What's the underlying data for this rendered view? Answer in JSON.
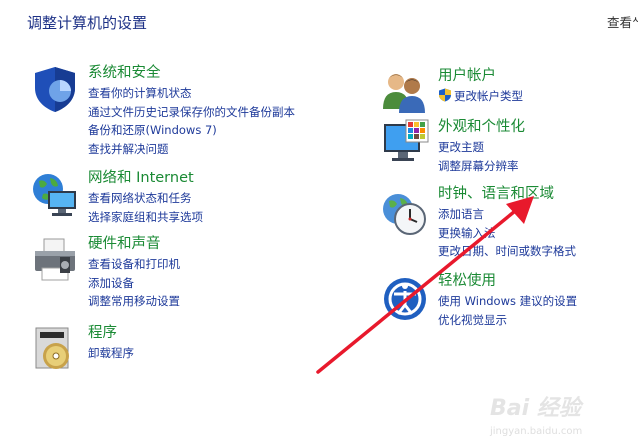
{
  "header": {
    "title": "调整计算机的设置",
    "view_by": "查看ᄊ"
  },
  "categories": {
    "system_security": {
      "title": "系统和安全",
      "icon": "shield-icon",
      "links": [
        "查看你的计算机状态",
        "通过文件历史记录保存你的文件备份副本",
        "备份和还原(Windows 7)",
        "查找并解决问题"
      ]
    },
    "network": {
      "title": "网络和 Internet",
      "icon": "network-globe-icon",
      "links": [
        "查看网络状态和任务",
        "选择家庭组和共享选项"
      ]
    },
    "hardware_sound": {
      "title": "硬件和声音",
      "icon": "printer-icon",
      "links": [
        "查看设备和打印机",
        "添加设备",
        "调整常用移动设置"
      ]
    },
    "programs": {
      "title": "程序",
      "icon": "programs-disc-icon",
      "links": [
        "卸载程序"
      ]
    },
    "user_accounts": {
      "title": "用户帐户",
      "icon": "users-icon",
      "links": [
        "更改帐户类型"
      ]
    },
    "appearance": {
      "title": "外观和个性化",
      "icon": "monitor-palette-icon",
      "links": [
        "更改主题",
        "调整屏幕分辨率"
      ]
    },
    "clock_region": {
      "title": "时钟、语言和区域",
      "icon": "clock-globe-icon",
      "links": [
        "添加语言",
        "更换输入法",
        "更改日期、时间或数字格式"
      ]
    },
    "ease_of_access": {
      "title": "轻松使用",
      "icon": "ease-of-access-icon",
      "links": [
        "使用 Windows 建议的设置",
        "优化视觉显示"
      ]
    }
  },
  "watermark": {
    "brand": "Bai 经验",
    "url": "jingyan.baidu.com"
  },
  "colors": {
    "title_green": "#1a8a34",
    "link_blue": "#1e3a9a",
    "header_blue": "#1e3287",
    "arrow_red": "#e8192c"
  }
}
